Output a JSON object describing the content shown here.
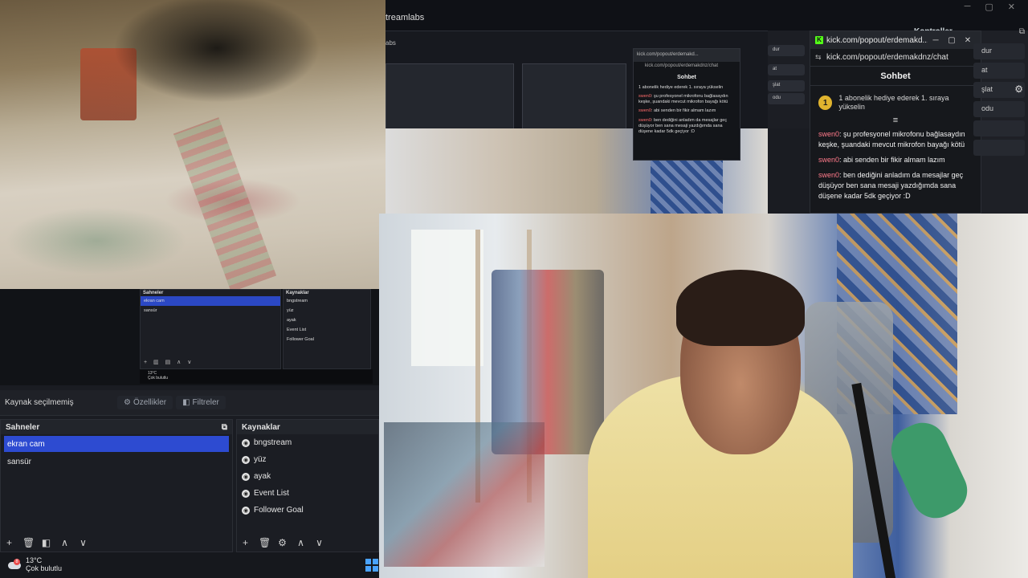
{
  "colors": {
    "accent": "#2d4bd1",
    "kick_green": "#53fc18",
    "chat_user": "#ff7a8a",
    "sub_badge": "#e0b32e"
  },
  "nested_app": {
    "title": "treamlabs",
    "sub_title": "abs",
    "controls_panel_title": "Kontroller",
    "side_buttons": [
      "dur",
      "at",
      "şlat",
      "odu"
    ]
  },
  "kick_chat": {
    "window_title": "kick.com/popout/erdemakd...",
    "url": "kick.com/popout/erdemakdnz/chat",
    "header": "Sohbet",
    "sub_badge_number": "1",
    "sub_notice": "1 abonelik hediye ederek 1. sıraya yükselin",
    "filter_icon": "filter-icon",
    "messages": [
      {
        "user": "swen0",
        "text": "şu profesyonel mikrofonu bağlasaydın keşke, şuandaki mevcut mikrofon bayağı kötü"
      },
      {
        "user": "swen0",
        "text": "abi senden bir fikir almam lazım"
      },
      {
        "user": "swen0",
        "text": "ben dediğini anladım da mesajlar geç düşüyor ben sana mesaji yazdığımda sana düşene kadar 5dk geçiyor :D"
      }
    ]
  },
  "mini_obs": {
    "scenes_header": "Sahneler",
    "sources_header": "Kaynaklar",
    "scenes": [
      "ekran cam",
      "sansür"
    ],
    "sources": [
      "bngstream",
      "yüz",
      "ayak",
      "Event List",
      "Follower Goal"
    ],
    "temp": "13°C",
    "weather": "Çok bulutlu"
  },
  "obs": {
    "no_source": "Kaynak seçilmemiş",
    "properties_btn": "Özellikler",
    "filters_btn": "Filtreler",
    "scenes_header": "Sahneler",
    "sources_header": "Kaynaklar",
    "scenes": [
      "ekran cam",
      "sansür"
    ],
    "active_scene": "ekran cam",
    "sources": [
      "bngstream",
      "yüz",
      "ayak",
      "Event List",
      "Follower Goal"
    ]
  },
  "taskbar": {
    "weather_badge": "8",
    "temp": "13°C",
    "weather": "Çok bulutlu"
  }
}
